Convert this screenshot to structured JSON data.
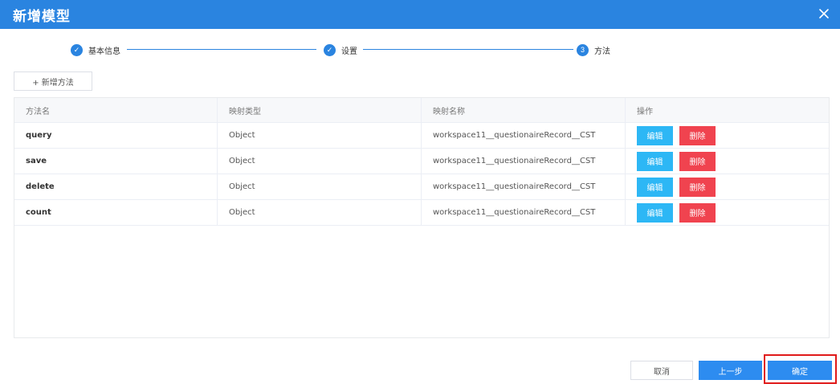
{
  "dialog": {
    "title": "新增模型"
  },
  "steps": [
    {
      "label": "基本信息",
      "marker": "✓",
      "status": "done"
    },
    {
      "label": "设置",
      "marker": "✓",
      "status": "done"
    },
    {
      "label": "方法",
      "marker": "3",
      "status": "active"
    }
  ],
  "toolbar": {
    "add_method_label": "+ 新增方法"
  },
  "table": {
    "headers": [
      "方法名",
      "映射类型",
      "映射名称",
      "操作"
    ],
    "rows": [
      {
        "name": "query",
        "type": "Object",
        "mapping": "workspace11__questionaireRecord__CST",
        "edit": "编辑",
        "delete": "删除"
      },
      {
        "name": "save",
        "type": "Object",
        "mapping": "workspace11__questionaireRecord__CST",
        "edit": "编辑",
        "delete": "删除"
      },
      {
        "name": "delete",
        "type": "Object",
        "mapping": "workspace11__questionaireRecord__CST",
        "edit": "编辑",
        "delete": "删除"
      },
      {
        "name": "count",
        "type": "Object",
        "mapping": "workspace11__questionaireRecord__CST",
        "edit": "编辑",
        "delete": "删除"
      }
    ]
  },
  "footer": {
    "cancel_label": "取消",
    "prev_label": "上一步",
    "confirm_label": "确定"
  },
  "colors": {
    "primary": "#2a84e0",
    "edit": "#2db7f5",
    "delete": "#f0434f",
    "highlight": "#e01a1a"
  },
  "icons": {
    "close": "close-icon",
    "step_done": "check-icon"
  }
}
